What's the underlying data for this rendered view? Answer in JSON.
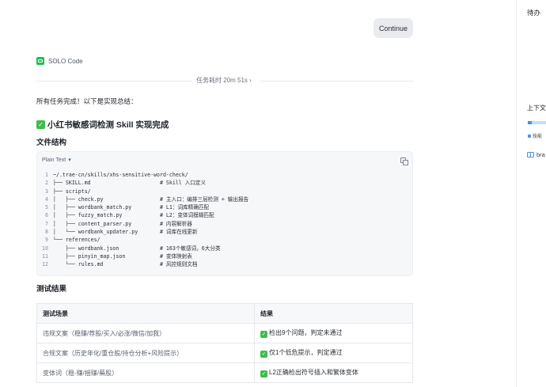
{
  "chat": {
    "continue_label": "Continue",
    "agent_name": "SOLO Code",
    "elapsed": "任务耗时 20m 51s",
    "elapsed_chevron": "›",
    "summary": "所有任务完成！以下是实现总结：",
    "heading": "小红书敏感词检测 Skill 实现完成",
    "files_heading": "文件结构",
    "tests_heading": "测试结果"
  },
  "code": {
    "language": "Plain Text",
    "lines": [
      {
        "n": "1",
        "t": "~/.trae-cn/skills/xhs-sensitive-word-check/"
      },
      {
        "n": "2",
        "t": "├── SKILL.md                      # Skill 入口定义"
      },
      {
        "n": "3",
        "t": "├── scripts/"
      },
      {
        "n": "4",
        "t": "│   ├── check.py                  # 主入口：编排三层检测 + 输出报告"
      },
      {
        "n": "5",
        "t": "│   ├── wordbank_match.py         # L1：词库精确匹配"
      },
      {
        "n": "6",
        "t": "│   ├── fuzzy_match.py            # L2：变体词模糊匹配"
      },
      {
        "n": "7",
        "t": "│   ├── content_parser.py         # 内容解析器"
      },
      {
        "n": "8",
        "t": "│   └── wordbank_updater.py       # 词库在线更新"
      },
      {
        "n": "9",
        "t": "└── references/"
      },
      {
        "n": "10",
        "t": "    ├── wordbank.json             # 163个敏感词，6大分类"
      },
      {
        "n": "11",
        "t": "    ├── pinyin_map.json           # 变体映射表"
      },
      {
        "n": "12",
        "t": "    └── rules.md                  # 风控规则文档"
      }
    ]
  },
  "tests": {
    "headers": [
      "测试场景",
      "结果"
    ],
    "rows": [
      {
        "scene": "违规文案（稳赚/荐股/买入/必涨/微信/加我）",
        "result": "检出9个问题，判定未通过"
      },
      {
        "scene": "合规文案（历史年化/重仓股/持仓分析+风险提示）",
        "result": "仅1个低危提示，判定通过"
      },
      {
        "scene": "变体词（稳-赚/揺赚/蕪股）",
        "result": "L2正确检出符号插入和繁体变体"
      }
    ]
  },
  "right_panel": {
    "title": "待办",
    "context_label": "上下文",
    "skill_label": "技能",
    "browse_label": "bra"
  },
  "colors": {
    "accent_green": "#3ebd4f",
    "accent_blue": "#4a90e2",
    "button_bg": "#e9ebee"
  }
}
